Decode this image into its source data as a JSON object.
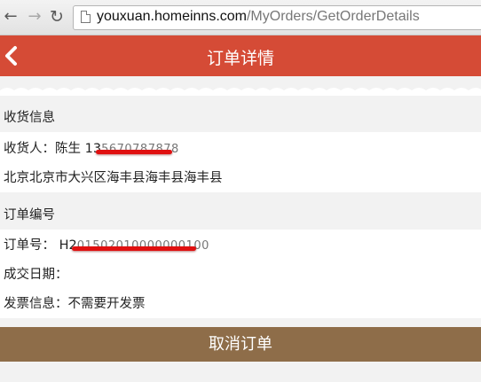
{
  "browser": {
    "url_host": "youxuan.homeinns.com",
    "url_path": "/MyOrders/GetOrderDetails"
  },
  "header": {
    "title": "订单详情"
  },
  "shipping": {
    "section_title": "收货信息",
    "receiver_label": "收货人：",
    "receiver_name": "陈生",
    "receiver_phone_visible": "13",
    "receiver_phone_obscured": "5670787878",
    "address": "北京北京市大兴区海丰县海丰县海丰县"
  },
  "order": {
    "section_title": "订单编号",
    "order_no_label": "订单号：",
    "order_no_visible": "H2",
    "order_no_obscured": "01502010000000100",
    "deal_date_label": "成交日期：",
    "deal_date_value": "",
    "invoice_label": "发票信息：",
    "invoice_value": "不需要开发票"
  },
  "actions": {
    "cancel_label": "取消订单"
  },
  "colors": {
    "header_bg": "#d54b36",
    "cancel_bg": "#8e6d49",
    "redaction": "#e01010"
  }
}
